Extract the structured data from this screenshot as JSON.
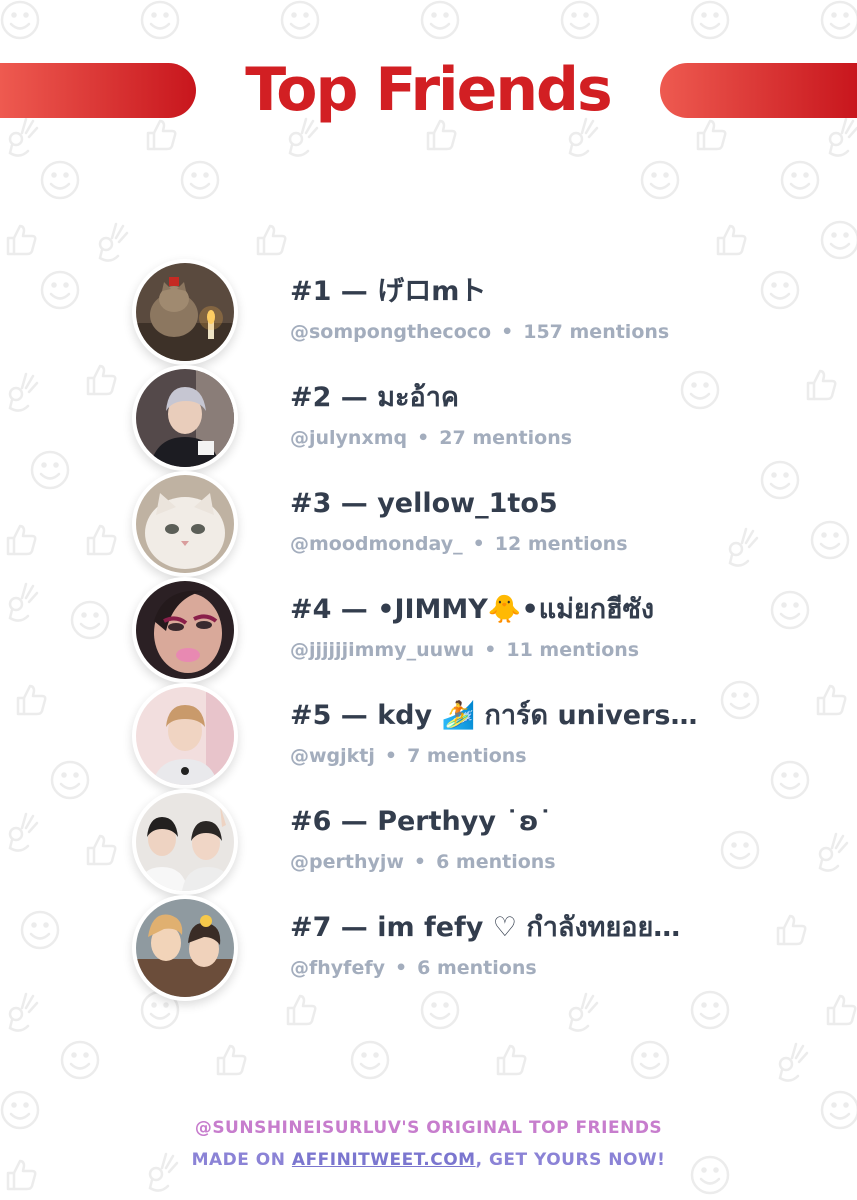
{
  "header": {
    "title": "Top Friends"
  },
  "friends": [
    {
      "rank_name": "#1 — げロmト",
      "handle": "@sompongthecoco",
      "mentions": "157 mentions",
      "avatar_icon": "cat-with-candle-photo"
    },
    {
      "rank_name": "#2 — มะอ้าค",
      "handle": "@julynxmq",
      "mentions": "27 mentions",
      "avatar_icon": "person-photo"
    },
    {
      "rank_name": "#3 — yellow_1to5",
      "handle": "@moodmonday_",
      "mentions": "12 mentions",
      "avatar_icon": "white-cat-photo"
    },
    {
      "rank_name": "#4 — •JIMMY🐥•แม่ยกฮีซัง",
      "handle": "@jjjjjjimmy_uuwu",
      "mentions": "11 mentions",
      "avatar_icon": "doll-photo"
    },
    {
      "rank_name": "#5 — kdy 🏄 การ์ด univers…",
      "handle": "@wgjktj",
      "mentions": "7 mentions",
      "avatar_icon": "person-photo"
    },
    {
      "rank_name": "#6 — Perthyy ˙ʚ˙",
      "handle": "@perthyjw",
      "mentions": "6 mentions",
      "avatar_icon": "two-people-photo"
    },
    {
      "rank_name": "#7 — im fefy ♡ กำลังทยอย…",
      "handle": "@fhyfefy",
      "mentions": "6 mentions",
      "avatar_icon": "two-people-photo"
    }
  ],
  "footer": {
    "line1": "@SUNSHINEISURLUV'S ORIGINAL TOP FRIENDS",
    "line2_prefix": "MADE ON ",
    "link": "AFFINITWEET.COM",
    "line2_suffix": ", GET YOURS NOW!"
  },
  "colors": {
    "accent_red": "#d21f23",
    "name_text": "#333d4d",
    "meta_text": "#a3adbd",
    "footer_pink": "#c77dcd",
    "footer_purple": "#8b83d6"
  }
}
